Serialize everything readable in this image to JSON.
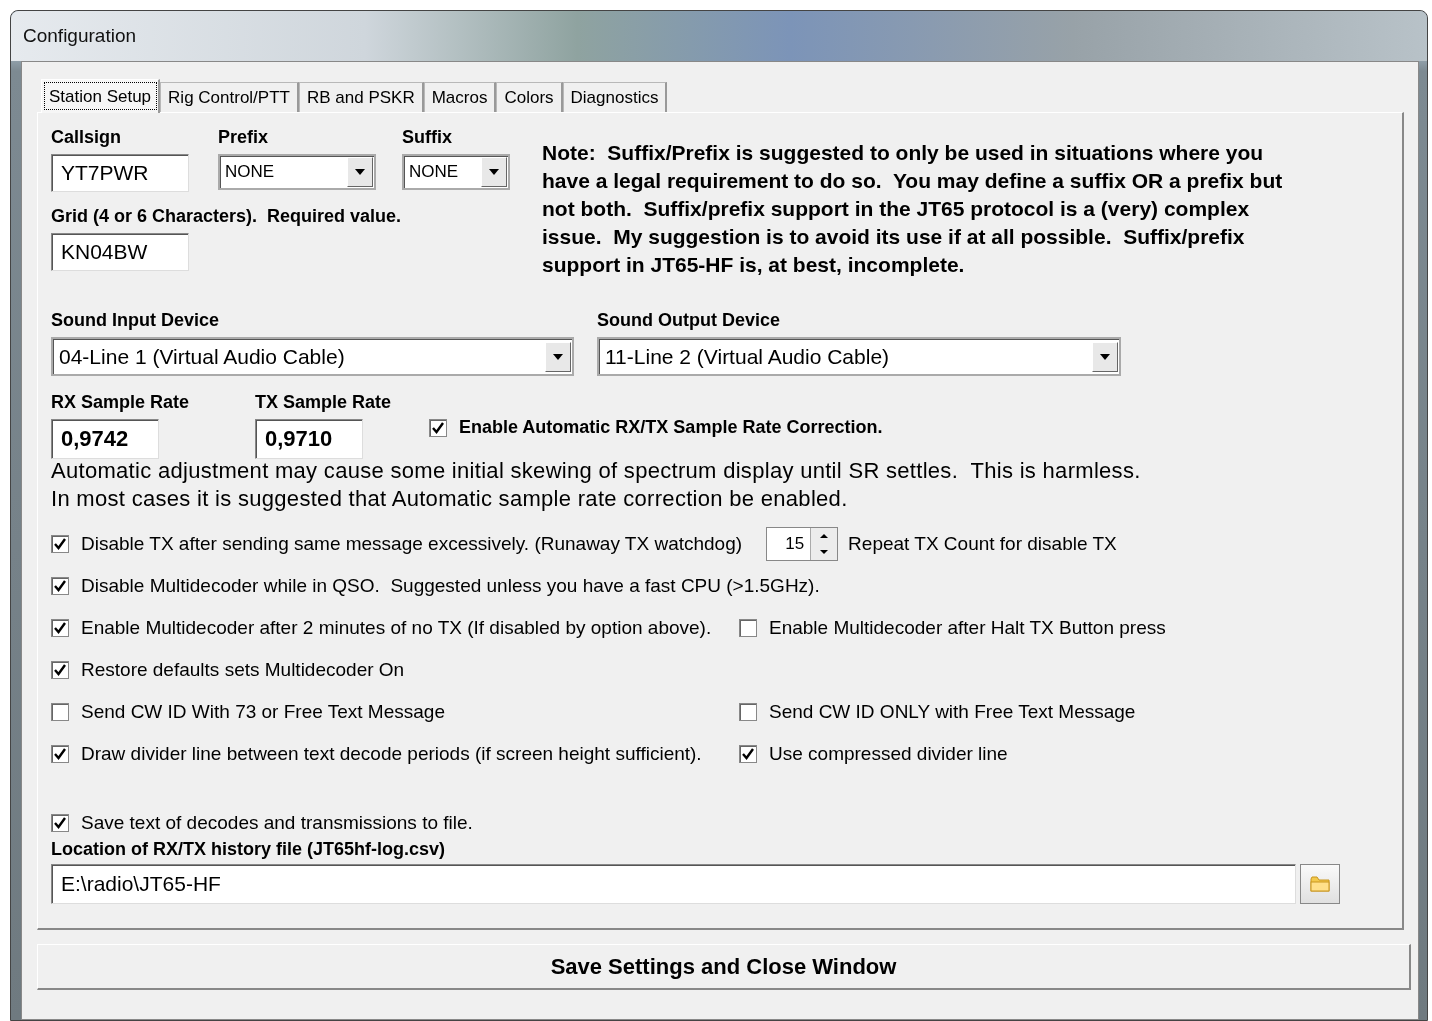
{
  "window": {
    "title": "Configuration"
  },
  "tabs": [
    {
      "label": "Station Setup",
      "selected": true
    },
    {
      "label": "Rig Control/PTT",
      "selected": false
    },
    {
      "label": "RB and PSKR",
      "selected": false
    },
    {
      "label": "Macros",
      "selected": false
    },
    {
      "label": "Colors",
      "selected": false
    },
    {
      "label": "Diagnostics",
      "selected": false
    }
  ],
  "callsign": {
    "label": "Callsign",
    "value": "YT7PWR"
  },
  "prefix": {
    "label": "Prefix",
    "value": "NONE"
  },
  "suffix": {
    "label": "Suffix",
    "value": "NONE"
  },
  "grid": {
    "label": "Grid (4 or 6 Characters).  Required value.",
    "value": "KN04BW"
  },
  "note": "Note:  Suffix/Prefix is suggested to only be used in situations where you have a legal requirement to do so.  You may define a suffix OR a prefix but not both.  Suffix/prefix support in the JT65 protocol is a (very) complex issue.  My suggestion is to avoid its use if at all possible.  Suffix/prefix support in JT65-HF is, at best, incomplete.",
  "sound_input": {
    "label": "Sound Input Device",
    "value": "04-Line 1 (Virtual Audio Cable)"
  },
  "sound_output": {
    "label": "Sound Output Device",
    "value": "11-Line 2 (Virtual Audio Cable)"
  },
  "rx_rate": {
    "label": "RX Sample Rate",
    "value": "0,9742"
  },
  "tx_rate": {
    "label": "TX Sample Rate",
    "value": "0,9710"
  },
  "auto_correction": {
    "label": "Enable Automatic RX/TX Sample Rate Correction.",
    "checked": true
  },
  "info_lines": [
    "Automatic adjustment may cause some initial skewing of spectrum display until SR settles.  This is harmless.",
    "In most cases it is suggested that Automatic sample rate correction be enabled."
  ],
  "option_rows": [
    {
      "items": [
        {
          "kind": "checkbox",
          "label": "Disable TX after sending same message excessively. (Runaway TX watchdog)",
          "checked": true
        },
        {
          "kind": "spinner",
          "value": "15",
          "label": "Repeat TX Count for disable TX"
        }
      ]
    },
    {
      "items": [
        {
          "kind": "checkbox",
          "label": "Disable Multidecoder while in QSO.  Suggested unless you have a fast CPU (>1.5GHz).",
          "checked": true
        }
      ]
    },
    {
      "items": [
        {
          "kind": "checkbox",
          "label": "Enable Multidecoder after 2 minutes of no TX (If disabled by option above).",
          "checked": true
        },
        {
          "kind": "checkbox",
          "label": "Enable Multidecoder after Halt TX Button press",
          "checked": false
        }
      ]
    },
    {
      "items": [
        {
          "kind": "checkbox",
          "label": "Restore defaults sets Multidecoder On",
          "checked": true
        }
      ]
    },
    {
      "items": [
        {
          "kind": "checkbox",
          "label": "Send CW ID With 73 or Free Text Message",
          "checked": false
        },
        {
          "kind": "checkbox",
          "label": "Send CW ID ONLY with Free Text Message",
          "checked": false
        }
      ]
    },
    {
      "items": [
        {
          "kind": "checkbox",
          "label": "Draw divider line between text decode periods (if screen height sufficient).",
          "checked": true
        },
        {
          "kind": "checkbox",
          "label": "Use compressed divider line",
          "checked": true
        }
      ]
    }
  ],
  "save_log": {
    "label": "Save text of decodes and transmissions to file.",
    "checked": true
  },
  "history": {
    "label": "Location of RX/TX history file (JT65hf-log.csv)",
    "value": "E:\\radio\\JT65-HF"
  },
  "save_button": "Save Settings and Close Window"
}
